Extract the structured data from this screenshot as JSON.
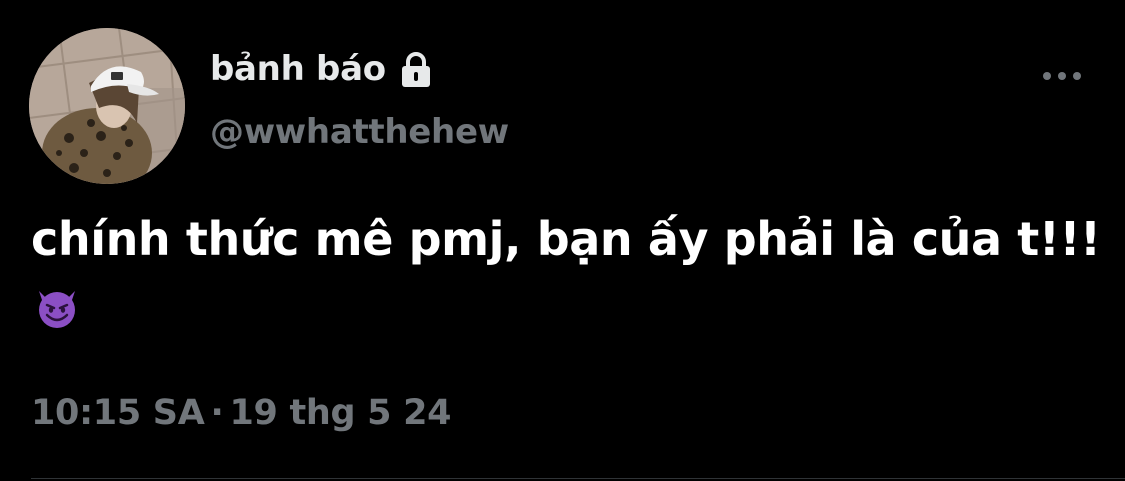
{
  "tweet": {
    "author": {
      "display_name": "bảnh báo",
      "handle": "@wwhatthehew",
      "protected_icon": "lock-icon",
      "avatar_icon": "avatar-photo"
    },
    "more_icon": "more-horizontal-icon",
    "text": "chính thức mê pmj, bạn ấy phải là của t!!!",
    "emoji": "smiling-devil-emoji",
    "timestamp": {
      "time": "10:15 SA",
      "separator": "·",
      "date": "19 thg 5 24"
    }
  },
  "colors": {
    "background": "#000000",
    "text_primary": "#ffffff",
    "text_secondary": "#71767b",
    "divider": "#2f3336",
    "emoji_purple": "#8b4fc4"
  }
}
